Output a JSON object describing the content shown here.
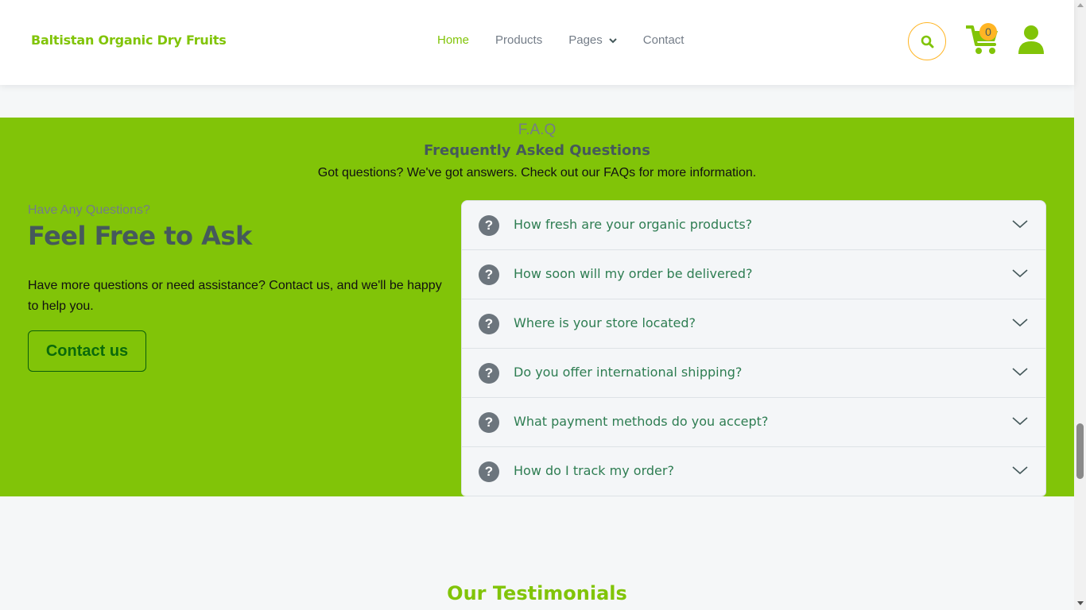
{
  "header": {
    "brand": "Baltistan Organic Dry Fruits",
    "nav": [
      {
        "label": "Home",
        "active": true
      },
      {
        "label": "Products",
        "active": false
      },
      {
        "label": "Pages",
        "active": false,
        "dropdown": true
      },
      {
        "label": "Contact",
        "active": false
      }
    ],
    "search_icon": "search-icon",
    "cart_icon": "cart-icon",
    "cart_count": "0",
    "user_icon": "user-icon"
  },
  "faq": {
    "eyebrow": "F.A.Q",
    "title": "Frequently Asked Questions",
    "subtitle": "Got questions? We've got answers. Check out our FAQs for more information.",
    "ask_eyebrow": "Have Any Questions?",
    "ask_title": "Feel Free to Ask",
    "ask_text": "Have more questions or need assistance? Contact us, and we'll be happy to help you.",
    "contact_button": "Contact us",
    "questions": [
      "How fresh are your organic products?",
      "How soon will my order be delivered?",
      "Where is your store located?",
      "Do you offer international shipping?",
      "What payment methods do you accept?",
      "How do I track my order?"
    ]
  },
  "testimonials": {
    "title": "Our Testimonials"
  },
  "colors": {
    "primary": "#81c408",
    "secondary": "#ffb524",
    "dark": "#45595b",
    "muted": "#747d88"
  }
}
